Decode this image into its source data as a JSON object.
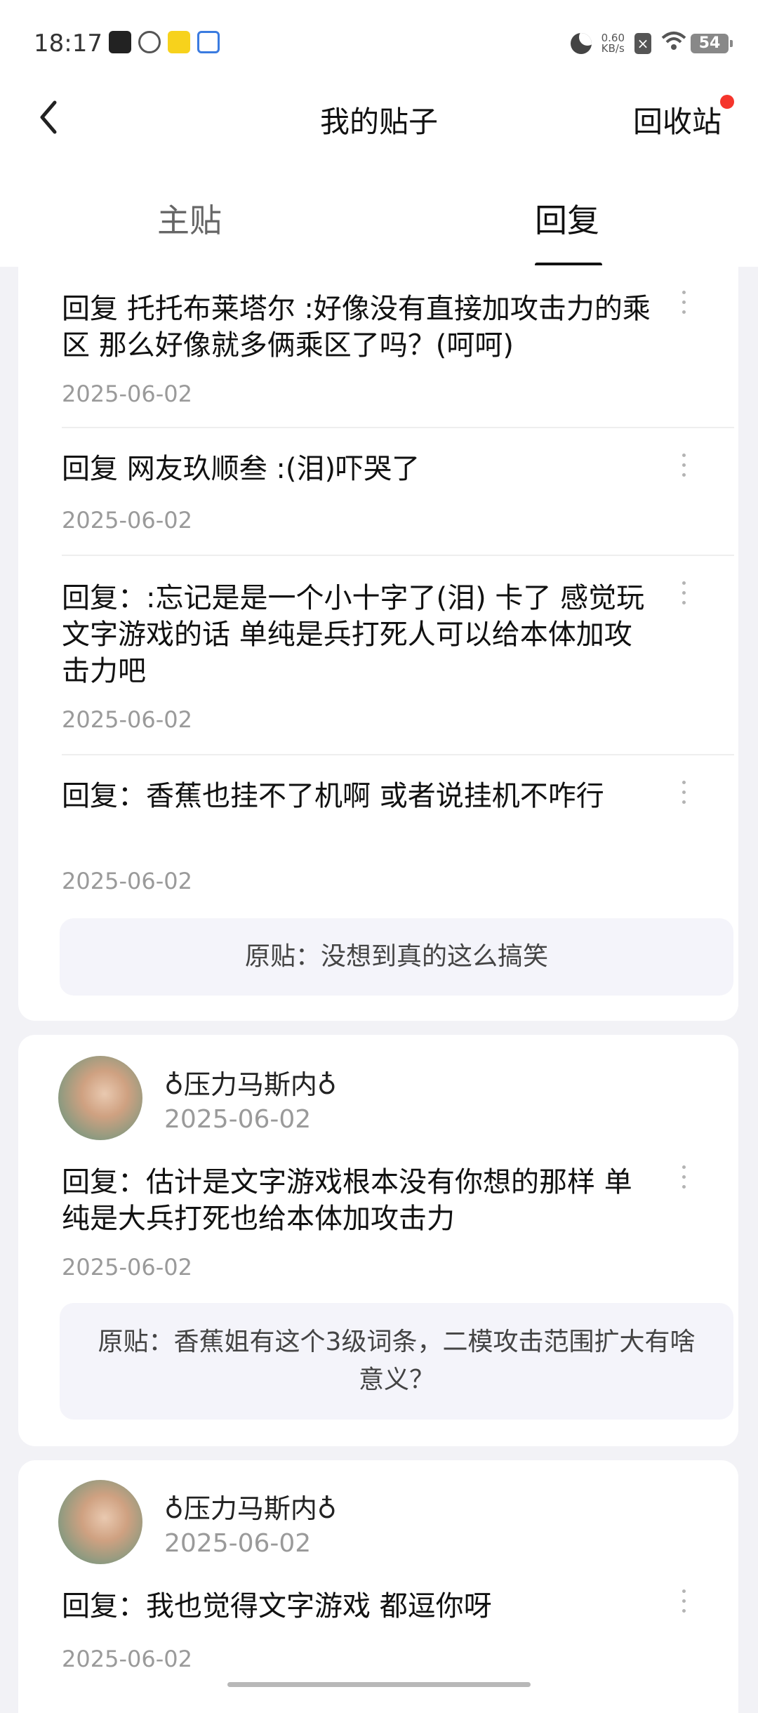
{
  "status_bar": {
    "time": "18:17",
    "net_speed_value": "0.60",
    "net_speed_unit": "KB/s",
    "battery": "54",
    "icons": [
      "moon-icon",
      "close-box-icon",
      "wifi-icon",
      "battery-icon"
    ]
  },
  "header": {
    "title": "我的贴子",
    "recycle_label": "回收站"
  },
  "tabs": [
    {
      "label": "主贴",
      "active": false
    },
    {
      "label": "回复",
      "active": true
    }
  ],
  "card1": {
    "replies": [
      {
        "text": "回复 托托布莱塔尔 :好像没有直接加攻击力的乘区 那么好像就多俩乘区了吗？(呵呵)",
        "date": "2025-06-02"
      },
      {
        "text": "回复 网友玖顺叁 :(泪)吓哭了",
        "date": "2025-06-02"
      },
      {
        "text": "回复：:忘记是是一个小十字了(泪) 卡了 感觉玩文字游戏的话 单纯是兵打死人可以给本体加攻击力吧",
        "date": "2025-06-02"
      },
      {
        "text": "回复：香蕉也挂不了机啊 或者说挂机不咋行",
        "date": "2025-06-02"
      }
    ],
    "origin": "原贴：没想到真的这么搞笑"
  },
  "card2": {
    "username": "♁压力马斯内♁",
    "user_date": "2025-06-02",
    "reply": {
      "text": "回复：估计是文字游戏根本没有你想的那样 单纯是大兵打死也给本体加攻击力",
      "date": "2025-06-02"
    },
    "origin": "原贴：香蕉姐有这个3级词条，二模攻击范围扩大有啥意义？"
  },
  "card3": {
    "username": "♁压力马斯内♁",
    "user_date": "2025-06-02",
    "reply": {
      "text": "回复：我也觉得文字游戏 都逗你呀",
      "date": "2025-06-02"
    }
  }
}
